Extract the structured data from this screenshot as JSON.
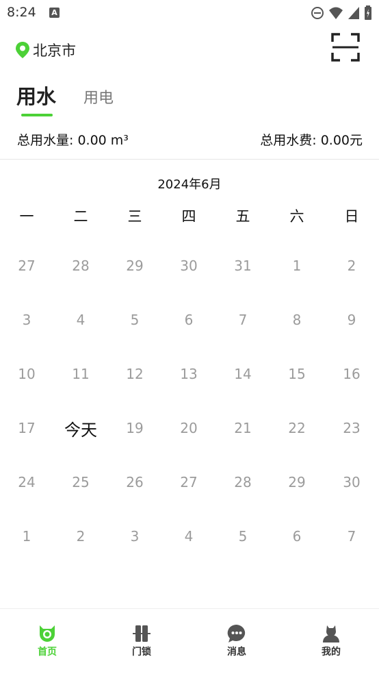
{
  "status_bar": {
    "time": "8:24",
    "notification_icon": "A"
  },
  "header": {
    "location": "北京市",
    "location_icon": "location-pin-icon",
    "scan_icon": "scan-icon",
    "accent_color": "#4cd137"
  },
  "tabs": [
    {
      "label": "用水",
      "active": true
    },
    {
      "label": "用电",
      "active": false
    }
  ],
  "summary": {
    "total_usage": "总用水量: 0.00 m³",
    "total_fee": "总用水费: 0.00元"
  },
  "calendar": {
    "title": "2024年6月",
    "weekdays": [
      "一",
      "二",
      "三",
      "四",
      "五",
      "六",
      "日"
    ],
    "weeks": [
      [
        "27",
        "28",
        "29",
        "30",
        "31",
        "1",
        "2"
      ],
      [
        "3",
        "4",
        "5",
        "6",
        "7",
        "8",
        "9"
      ],
      [
        "10",
        "11",
        "12",
        "13",
        "14",
        "15",
        "16"
      ],
      [
        "17",
        "今天",
        "19",
        "20",
        "21",
        "22",
        "23"
      ],
      [
        "24",
        "25",
        "26",
        "27",
        "28",
        "29",
        "30"
      ],
      [
        "1",
        "2",
        "3",
        "4",
        "5",
        "6",
        "7"
      ]
    ],
    "today_label": "今天"
  },
  "bottom_nav": [
    {
      "label": "首页",
      "icon": "home-icon",
      "active": true
    },
    {
      "label": "门锁",
      "icon": "door-lock-icon",
      "active": false
    },
    {
      "label": "消息",
      "icon": "message-icon",
      "active": false
    },
    {
      "label": "我的",
      "icon": "profile-icon",
      "active": false
    }
  ]
}
